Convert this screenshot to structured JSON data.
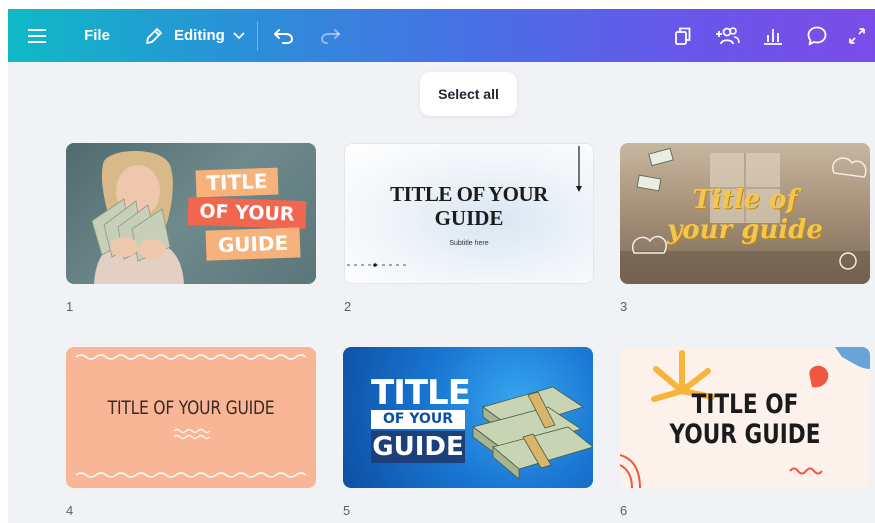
{
  "toolbar": {
    "file_label": "File",
    "editing_label": "Editing",
    "icons": [
      "menu-icon",
      "pencil-icon",
      "chevron-down-icon",
      "undo-icon",
      "redo-icon",
      "copy-pages-icon",
      "add-people-icon",
      "analytics-icon",
      "comment-icon",
      "expand-icon"
    ]
  },
  "select_all_label": "Select all",
  "colors": {
    "gradient_start": "#0fb9c6",
    "gradient_end": "#7b4de8",
    "canvas_bg": "#f1f2f6"
  },
  "pages": [
    {
      "number": "1",
      "lines": [
        "TITLE",
        "OF YOUR",
        "GUIDE"
      ]
    },
    {
      "number": "2",
      "lines": [
        "TITLE OF YOUR",
        "GUIDE"
      ],
      "subtitle": "Subtitle here"
    },
    {
      "number": "3",
      "lines": [
        "Title of",
        "your guide"
      ]
    },
    {
      "number": "4",
      "lines": [
        "TITLE OF YOUR GUIDE"
      ]
    },
    {
      "number": "5",
      "lines": [
        "TITLE",
        "OF YOUR",
        "GUIDE"
      ]
    },
    {
      "number": "6",
      "lines": [
        "TITLE OF",
        "YOUR GUIDE"
      ]
    }
  ]
}
